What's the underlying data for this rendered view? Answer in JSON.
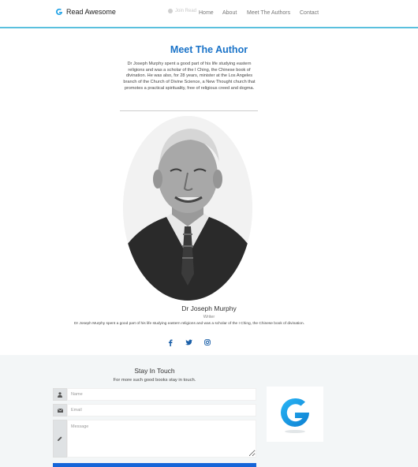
{
  "navbar": {
    "brand": "Read Awesome",
    "ghost_text": "Join Read",
    "links": [
      "Home",
      "About",
      "Meet The Authors",
      "Contact"
    ]
  },
  "author_section": {
    "title": "Meet The Author",
    "intro": "Dr Joseph Murphy spent a good part of his life studying eastern religions and was a scholar of the I Ching, the Chinese book of divination. He was also, for 28 years, minister at the Los Angeles branch of the Church of Divine Science, a New Thought church that promotes a practical spirituality, free of religious creed and dogma.",
    "name": "Dr Joseph Murphy",
    "role": "Writer",
    "bio": "Dr Joseph Murphy spent a good part of his life studying eastern religions and was a scholar of the I Ching, the Chinese book of divination.",
    "social_icons": [
      "facebook-icon",
      "twitter-icon",
      "instagram-icon"
    ]
  },
  "contact": {
    "title": "Stay In Touch",
    "subtitle": "For more such good books stay in touch.",
    "name_placeholder": "Name",
    "email_placeholder": "Email",
    "message_placeholder": "Message"
  },
  "colors": {
    "accent": "#1a73c8",
    "navbar_rule": "#5bc0de",
    "button": "#1565d8",
    "logo_blue": "#1da1e6"
  }
}
